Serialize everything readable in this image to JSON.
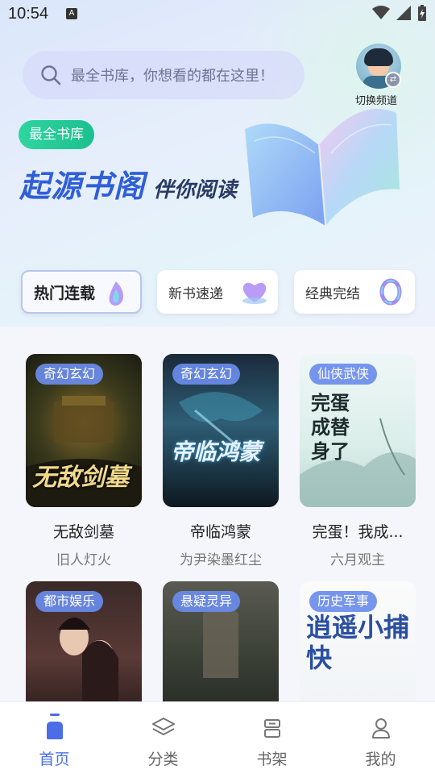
{
  "status_bar": {
    "time": "10:54",
    "notification_letter": "A"
  },
  "search": {
    "placeholder": "最全书库，你想看的都在这里！"
  },
  "channel_switch": {
    "label": "切换频道"
  },
  "banner": {
    "badge": "最全书库",
    "title": "起源书阁",
    "slogan": "伴你阅读"
  },
  "categories": [
    {
      "label": "热门连载",
      "active": true
    },
    {
      "label": "新书速递",
      "active": false
    },
    {
      "label": "经典完结",
      "active": false
    }
  ],
  "books": [
    {
      "genre": "奇幻玄幻",
      "title": "无敌剑墓",
      "author": "旧人灯火",
      "cover_text": "无敌剑墓"
    },
    {
      "genre": "奇幻玄幻",
      "title": "帝临鸿蒙",
      "author": "为尹染墨红尘",
      "cover_text": "帝临鸿蒙"
    },
    {
      "genre": "仙侠武侠",
      "title": "完蛋！我成...",
      "author": "六月观主",
      "cover_text": "完蛋 成替身了"
    },
    {
      "genre": "都市娱乐",
      "title": "",
      "author": "",
      "cover_text": ""
    },
    {
      "genre": "悬疑灵异",
      "title": "",
      "author": "",
      "cover_text": ""
    },
    {
      "genre": "历史军事",
      "title": "",
      "author": "",
      "cover_text": "逍遥小捕快"
    }
  ],
  "nav": [
    {
      "label": "首页",
      "icon": "home-icon",
      "active": true
    },
    {
      "label": "分类",
      "icon": "layers-icon",
      "active": false
    },
    {
      "label": "书架",
      "icon": "bookshelf-icon",
      "active": false
    },
    {
      "label": "我的",
      "icon": "profile-icon",
      "active": false
    }
  ],
  "colors": {
    "accent": "#4a6ee8",
    "badge_green": "#1cc08e",
    "genre_tag": "#6a8cec"
  }
}
